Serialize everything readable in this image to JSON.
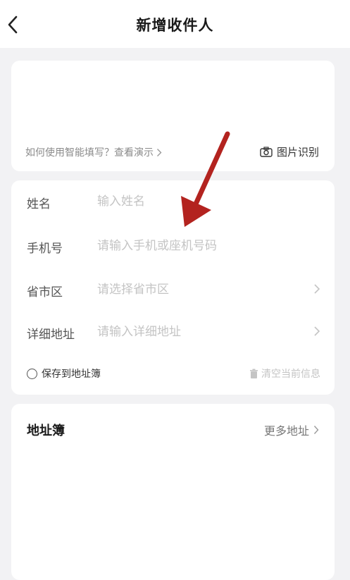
{
  "header": {
    "title": "新增收件人"
  },
  "smart_fill": {
    "hint": "如何使用智能填写？查看演示",
    "photo_label": "图片识别"
  },
  "form": {
    "fields": [
      {
        "label": "姓名",
        "placeholder": "输入姓名"
      },
      {
        "label": "手机号",
        "placeholder": "请输入手机或座机号码"
      },
      {
        "label": "省市区",
        "placeholder": "请选择省市区"
      },
      {
        "label": "详细地址",
        "placeholder": "请输入详细地址"
      }
    ],
    "save_label": "保存到地址簿",
    "clear_label": "清空当前信息"
  },
  "address_book": {
    "title": "地址簿",
    "more_label": "更多地址"
  },
  "colors": {
    "background": "#f2f2f4",
    "card": "#ffffff",
    "annotation_arrow": "#b3231f"
  },
  "icons": [
    "back-arrow-icon",
    "camera-icon",
    "chevron-right-icon",
    "trash-icon",
    "radio-unchecked-icon"
  ]
}
